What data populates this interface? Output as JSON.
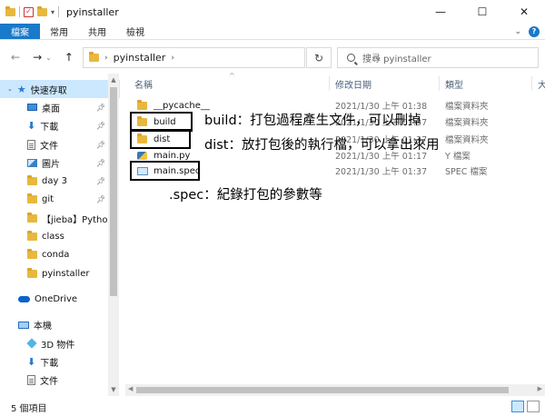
{
  "window": {
    "title": "pyinstaller",
    "minimize": "—",
    "maximize": "☐",
    "close": "✕"
  },
  "ribbon": {
    "tabs": [
      "檔案",
      "常用",
      "共用",
      "檢視"
    ]
  },
  "address": {
    "path": "pyinstaller",
    "search_placeholder": "搜尋 pyinstaller"
  },
  "sidebar": {
    "items": [
      {
        "label": "快速存取",
        "icon": "star-icon",
        "level": "top",
        "pinned": false
      },
      {
        "label": "桌面",
        "icon": "desktop-icon",
        "level": "sub",
        "pinned": true
      },
      {
        "label": "下載",
        "icon": "download-icon",
        "level": "sub",
        "pinned": true
      },
      {
        "label": "文件",
        "icon": "document-icon",
        "level": "sub",
        "pinned": true
      },
      {
        "label": "圖片",
        "icon": "pictures-icon",
        "level": "sub",
        "pinned": true
      },
      {
        "label": "day 3",
        "icon": "folder-icon",
        "level": "sub",
        "pinned": true
      },
      {
        "label": "git",
        "icon": "folder-icon",
        "level": "sub",
        "pinned": true
      },
      {
        "label": "【jieba】Python",
        "icon": "folder-icon",
        "level": "sub",
        "pinned": false
      },
      {
        "label": "class",
        "icon": "folder-icon",
        "level": "sub",
        "pinned": false
      },
      {
        "label": "conda",
        "icon": "folder-icon",
        "level": "sub",
        "pinned": false
      },
      {
        "label": "pyinstaller",
        "icon": "folder-icon",
        "level": "sub",
        "pinned": false
      },
      {
        "label": "OneDrive",
        "icon": "onedrive-icon",
        "level": "top",
        "pinned": false
      },
      {
        "label": "本機",
        "icon": "this-pc-icon",
        "level": "top",
        "pinned": false
      },
      {
        "label": "3D 物件",
        "icon": "3d-objects-icon",
        "level": "sub",
        "pinned": false
      },
      {
        "label": "下載",
        "icon": "download-icon",
        "level": "sub",
        "pinned": false
      },
      {
        "label": "文件",
        "icon": "document-icon",
        "level": "sub",
        "pinned": false
      }
    ]
  },
  "columns": {
    "name": "名稱",
    "date": "修改日期",
    "type": "類型",
    "size": "大"
  },
  "files": [
    {
      "name": "__pycache__",
      "date": "2021/1/30 上午 01:38",
      "type": "檔案資料夾",
      "icon": "folder-icon"
    },
    {
      "name": "build",
      "date": "2021/1/30 上午 01:37",
      "type": "檔案資料夾",
      "icon": "folder-icon"
    },
    {
      "name": "dist",
      "date": "2021/1/30 上午 01:37",
      "type": "檔案資料夾",
      "icon": "folder-icon"
    },
    {
      "name": "main.py",
      "date": "2021/1/30 上午 01:17",
      "type": "Y 檔案",
      "icon": "python-file-icon"
    },
    {
      "name": "main.spec",
      "date": "2021/1/30 上午 01:37",
      "type": "SPEC 檔案",
      "icon": "spec-file-icon"
    }
  ],
  "annotations": {
    "build": "build：打包過程產生文件，可以刪掉",
    "dist": "dist：放打包後的執行檔，可以拿出來用",
    "spec": ".spec：紀錄打包的參數等"
  },
  "status": {
    "count": "5 個項目"
  }
}
